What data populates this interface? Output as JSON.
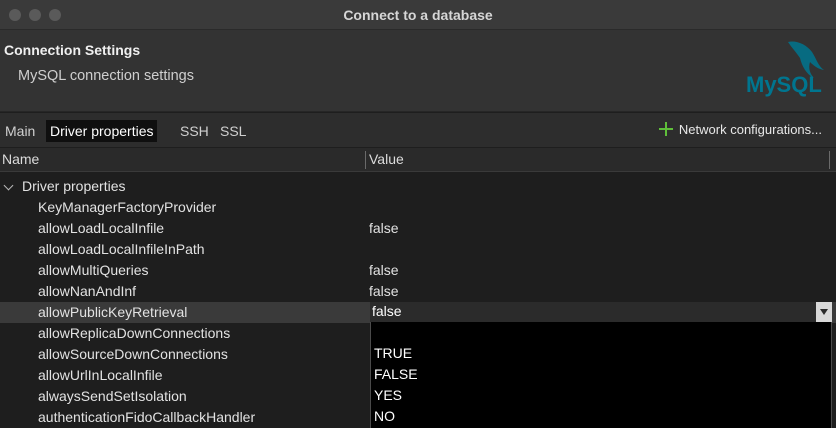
{
  "window": {
    "title": "Connect to a database"
  },
  "header": {
    "title": "Connection Settings",
    "subtitle": "MySQL connection settings",
    "logo_text": "MySQL"
  },
  "tabs": [
    {
      "label": "Main",
      "active": false
    },
    {
      "label": "Driver properties",
      "active": true
    },
    {
      "label": "SSH",
      "active": false
    },
    {
      "label": "SSL",
      "active": false
    }
  ],
  "network_button": {
    "label": "Network configurations..."
  },
  "columns": {
    "name": "Name",
    "value": "Value"
  },
  "group": {
    "label": "Driver properties"
  },
  "properties": [
    {
      "name": "KeyManagerFactoryProvider",
      "value": ""
    },
    {
      "name": "allowLoadLocalInfile",
      "value": "false"
    },
    {
      "name": "allowLoadLocalInfileInPath",
      "value": ""
    },
    {
      "name": "allowMultiQueries",
      "value": "false"
    },
    {
      "name": "allowNanAndInf",
      "value": "false"
    },
    {
      "name": "allowPublicKeyRetrieval",
      "value": "false"
    },
    {
      "name": "allowReplicaDownConnections",
      "value": ""
    },
    {
      "name": "allowSourceDownConnections",
      "value": ""
    },
    {
      "name": "allowUrlInLocalInfile",
      "value": ""
    },
    {
      "name": "alwaysSendSetIsolation",
      "value": ""
    },
    {
      "name": "authenticationFidoCallbackHandler",
      "value": ""
    }
  ],
  "editor": {
    "selected_value": "false",
    "options": [
      "TRUE",
      "FALSE",
      "YES",
      "NO"
    ]
  },
  "colors": {
    "accent_green": "#5fbf3a",
    "mysql_blue": "#00758f",
    "mysql_orange": "#f29111"
  }
}
